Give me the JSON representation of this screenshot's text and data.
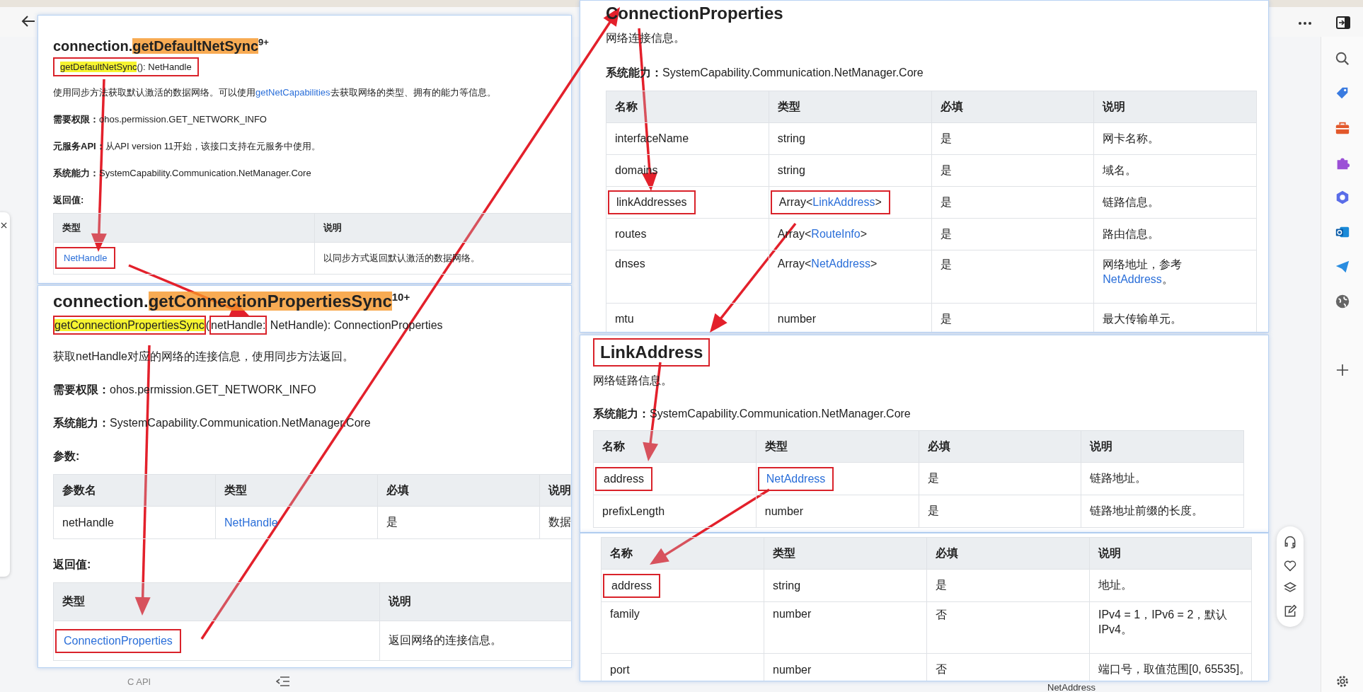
{
  "panels": [
    {
      "blocks": [
        {
          "kind": "heading",
          "boxed": false,
          "parts": [
            {
              "text": "connection.",
              "highlight": false
            },
            {
              "text": "getDefaultNetSync",
              "highlight": true
            }
          ],
          "version": "9+"
        },
        {
          "kind": "signature",
          "groups": [
            {
              "boxed": true,
              "parts": [
                {
                  "text": "getDefaultNetSync",
                  "highlight": true
                },
                {
                  "text": "(): NetHandle",
                  "highlight": false
                }
              ]
            }
          ]
        },
        {
          "kind": "paragraph",
          "parts": [
            {
              "text": "使用同步方法获取默认激活的数据网络。可以使用",
              "link": false
            },
            {
              "text": "getNetCapabilities",
              "link": true
            },
            {
              "text": "去获取网络的类型、拥有的能力等信息。",
              "link": false
            }
          ]
        },
        {
          "kind": "field",
          "label": "需要权限：",
          "value": "ohos.permission.GET_NETWORK_INFO"
        },
        {
          "kind": "field",
          "label": "元服务API：",
          "value": "从API version 11开始，该接口支持在元服务中使用。"
        },
        {
          "kind": "field",
          "label": "系统能力：",
          "value": "SystemCapability.Communication.NetManager.Core"
        },
        {
          "kind": "label",
          "text": "返回值:"
        },
        {
          "kind": "table",
          "columns": [
            "类型",
            "说明"
          ],
          "rows": [
            [
              {
                "boxed": true,
                "parts": [
                  {
                    "text": "NetHandle",
                    "link": true
                  }
                ]
              },
              {
                "boxed": false,
                "parts": [
                  {
                    "text": "以同步方式返回默认激活的数据网络。",
                    "link": false
                  }
                ]
              }
            ]
          ]
        }
      ]
    },
    {
      "blocks": [
        {
          "kind": "heading",
          "boxed": false,
          "parts": [
            {
              "text": "connection.",
              "highlight": false
            },
            {
              "text": "getConnectionPropertiesSync",
              "highlight": true
            }
          ],
          "version": "10+"
        },
        {
          "kind": "signature",
          "groups": [
            {
              "boxed": true,
              "parts": [
                {
                  "text": "getConnectionPropertiesSync",
                  "highlight": true
                }
              ]
            },
            {
              "boxed": false,
              "parts": [
                {
                  "text": "(",
                  "highlight": false
                }
              ]
            },
            {
              "boxed": true,
              "parts": [
                {
                  "text": "netHandle:",
                  "highlight": false
                }
              ]
            },
            {
              "boxed": false,
              "parts": [
                {
                  "text": " NetHandle): ConnectionProperties",
                  "highlight": false
                }
              ]
            }
          ]
        },
        {
          "kind": "paragraph",
          "parts": [
            {
              "text": "获取netHandle对应的网络的连接信息，使用同步方法返回。",
              "link": false
            }
          ]
        },
        {
          "kind": "field",
          "label": "需要权限：",
          "value": "ohos.permission.GET_NETWORK_INFO"
        },
        {
          "kind": "field",
          "label": "系统能力：",
          "value": "SystemCapability.Communication.NetManager.Core"
        },
        {
          "kind": "label",
          "text": "参数:"
        },
        {
          "kind": "table",
          "columns": [
            "参数名",
            "类型",
            "必填",
            "说明"
          ],
          "rows": [
            [
              {
                "boxed": false,
                "parts": [
                  {
                    "text": "netHandle",
                    "link": false
                  }
                ]
              },
              {
                "boxed": false,
                "parts": [
                  {
                    "text": "NetHandle",
                    "link": true
                  }
                ]
              },
              {
                "boxed": false,
                "parts": [
                  {
                    "text": "是",
                    "link": false
                  }
                ]
              },
              {
                "boxed": false,
                "parts": [
                  {
                    "text": "数据",
                    "link": false
                  }
                ]
              }
            ]
          ]
        },
        {
          "kind": "label",
          "text": "返回值:"
        },
        {
          "kind": "table",
          "columns": [
            "类型",
            "说明"
          ],
          "rows": [
            [
              {
                "boxed": true,
                "parts": [
                  {
                    "text": "ConnectionProperties",
                    "link": true
                  }
                ]
              },
              {
                "boxed": false,
                "parts": [
                  {
                    "text": "返回网络的连接信息。",
                    "link": false
                  }
                ]
              }
            ]
          ]
        }
      ]
    },
    {
      "blocks": [
        {
          "kind": "heading",
          "boxed": false,
          "parts": [
            {
              "text": "ConnectionProperties",
              "highlight": false
            }
          ]
        },
        {
          "kind": "paragraph",
          "parts": [
            {
              "text": "网络连接信息。",
              "link": false
            }
          ]
        },
        {
          "kind": "field",
          "label": "系统能力：",
          "value": "SystemCapability.Communication.NetManager.Core"
        },
        {
          "kind": "table",
          "columns": [
            "名称",
            "类型",
            "必填",
            "说明"
          ],
          "rows": [
            [
              {
                "boxed": false,
                "parts": [
                  {
                    "text": "interfaceName",
                    "link": false
                  }
                ]
              },
              {
                "boxed": false,
                "parts": [
                  {
                    "text": "string",
                    "link": false
                  }
                ]
              },
              {
                "boxed": false,
                "parts": [
                  {
                    "text": "是",
                    "link": false
                  }
                ]
              },
              {
                "boxed": false,
                "parts": [
                  {
                    "text": "网卡名称。",
                    "link": false
                  }
                ]
              }
            ],
            [
              {
                "boxed": false,
                "parts": [
                  {
                    "text": "domains",
                    "link": false
                  }
                ]
              },
              {
                "boxed": false,
                "parts": [
                  {
                    "text": "string",
                    "link": false
                  }
                ]
              },
              {
                "boxed": false,
                "parts": [
                  {
                    "text": "是",
                    "link": false
                  }
                ]
              },
              {
                "boxed": false,
                "parts": [
                  {
                    "text": "域名。",
                    "link": false
                  }
                ]
              }
            ],
            [
              {
                "boxed": true,
                "parts": [
                  {
                    "text": "linkAddresses",
                    "link": false
                  }
                ]
              },
              {
                "boxed": true,
                "parts": [
                  {
                    "text": "Array<",
                    "link": false
                  },
                  {
                    "text": "LinkAddress",
                    "link": true
                  },
                  {
                    "text": ">",
                    "link": false
                  }
                ]
              },
              {
                "boxed": false,
                "parts": [
                  {
                    "text": "是",
                    "link": false
                  }
                ]
              },
              {
                "boxed": false,
                "parts": [
                  {
                    "text": "链路信息。",
                    "link": false
                  }
                ]
              }
            ],
            [
              {
                "boxed": false,
                "parts": [
                  {
                    "text": "routes",
                    "link": false
                  }
                ]
              },
              {
                "boxed": false,
                "parts": [
                  {
                    "text": "Array<",
                    "link": false
                  },
                  {
                    "text": "RouteInfo",
                    "link": true
                  },
                  {
                    "text": ">",
                    "link": false
                  }
                ]
              },
              {
                "boxed": false,
                "parts": [
                  {
                    "text": "是",
                    "link": false
                  }
                ]
              },
              {
                "boxed": false,
                "parts": [
                  {
                    "text": "路由信息。",
                    "link": false
                  }
                ]
              }
            ],
            [
              {
                "boxed": false,
                "parts": [
                  {
                    "text": "dnses",
                    "link": false
                  }
                ]
              },
              {
                "boxed": false,
                "parts": [
                  {
                    "text": "Array<",
                    "link": false
                  },
                  {
                    "text": "NetAddress",
                    "link": true
                  },
                  {
                    "text": ">",
                    "link": false
                  }
                ]
              },
              {
                "boxed": false,
                "parts": [
                  {
                    "text": "是",
                    "link": false
                  }
                ]
              },
              {
                "boxed": false,
                "parts": [
                  {
                    "text": "网络地址，参考 ",
                    "link": false
                  },
                  {
                    "text": "NetAddress",
                    "link": true
                  },
                  {
                    "text": "。",
                    "link": false
                  }
                ]
              }
            ],
            [
              {
                "boxed": false,
                "parts": [
                  {
                    "text": "mtu",
                    "link": false
                  }
                ]
              },
              {
                "boxed": false,
                "parts": [
                  {
                    "text": "number",
                    "link": false
                  }
                ]
              },
              {
                "boxed": false,
                "parts": [
                  {
                    "text": "是",
                    "link": false
                  }
                ]
              },
              {
                "boxed": false,
                "parts": [
                  {
                    "text": "最大传输单元。",
                    "link": false
                  }
                ]
              }
            ]
          ]
        }
      ]
    },
    {
      "blocks": [
        {
          "kind": "heading",
          "boxed": true,
          "parts": [
            {
              "text": "LinkAddress",
              "highlight": false
            }
          ]
        },
        {
          "kind": "paragraph",
          "parts": [
            {
              "text": "网络链路信息。",
              "link": false
            }
          ]
        },
        {
          "kind": "field",
          "label": "系统能力：",
          "value": "SystemCapability.Communication.NetManager.Core"
        },
        {
          "kind": "table",
          "columns": [
            "名称",
            "类型",
            "必填",
            "说明"
          ],
          "rows": [
            [
              {
                "boxed": true,
                "parts": [
                  {
                    "text": "address",
                    "link": false
                  }
                ]
              },
              {
                "boxed": true,
                "parts": [
                  {
                    "text": "NetAddress",
                    "link": true
                  }
                ]
              },
              {
                "boxed": false,
                "parts": [
                  {
                    "text": "是",
                    "link": false
                  }
                ]
              },
              {
                "boxed": false,
                "parts": [
                  {
                    "text": "链路地址。",
                    "link": false
                  }
                ]
              }
            ],
            [
              {
                "boxed": false,
                "parts": [
                  {
                    "text": "prefixLength",
                    "link": false
                  }
                ]
              },
              {
                "boxed": false,
                "parts": [
                  {
                    "text": "number",
                    "link": false
                  }
                ]
              },
              {
                "boxed": false,
                "parts": [
                  {
                    "text": "是",
                    "link": false
                  }
                ]
              },
              {
                "boxed": false,
                "parts": [
                  {
                    "text": "链路地址前缀的长度。",
                    "link": false
                  }
                ]
              }
            ]
          ]
        }
      ]
    },
    {
      "blocks": [
        {
          "kind": "table",
          "columns": [
            "名称",
            "类型",
            "必填",
            "说明"
          ],
          "rows": [
            [
              {
                "boxed": true,
                "parts": [
                  {
                    "text": "address",
                    "link": false
                  }
                ]
              },
              {
                "boxed": false,
                "parts": [
                  {
                    "text": "string",
                    "link": false
                  }
                ]
              },
              {
                "boxed": false,
                "parts": [
                  {
                    "text": "是",
                    "link": false
                  }
                ]
              },
              {
                "boxed": false,
                "parts": [
                  {
                    "text": "地址。",
                    "link": false
                  }
                ]
              }
            ],
            [
              {
                "boxed": false,
                "parts": [
                  {
                    "text": "family",
                    "link": false
                  }
                ]
              },
              {
                "boxed": false,
                "parts": [
                  {
                    "text": "number",
                    "link": false
                  }
                ]
              },
              {
                "boxed": false,
                "parts": [
                  {
                    "text": "否",
                    "link": false
                  }
                ]
              },
              {
                "boxed": false,
                "parts": [
                  {
                    "text": "IPv4 = 1，IPv6 = 2，默认IPv4。",
                    "link": false
                  }
                ]
              }
            ],
            [
              {
                "boxed": false,
                "parts": [
                  {
                    "text": "port",
                    "link": false
                  }
                ]
              },
              {
                "boxed": false,
                "parts": [
                  {
                    "text": "number",
                    "link": false
                  }
                ]
              },
              {
                "boxed": false,
                "parts": [
                  {
                    "text": "否",
                    "link": false
                  }
                ]
              },
              {
                "boxed": false,
                "parts": [
                  {
                    "text": "端口号，取值范围[0, 65535]。",
                    "link": false
                  }
                ]
              }
            ]
          ]
        }
      ]
    }
  ],
  "background": {
    "nav_item": "C API",
    "footer_link": "NetAddress"
  }
}
